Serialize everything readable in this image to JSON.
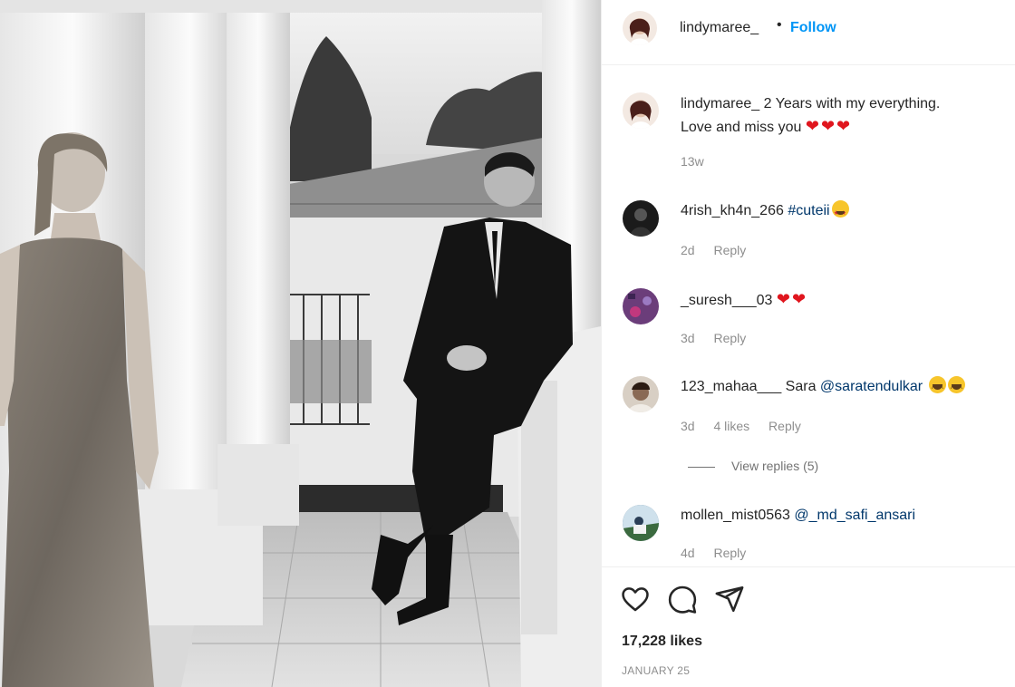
{
  "post": {
    "username": "lindymaree_",
    "separator": "•",
    "follow_label": "Follow",
    "caption": {
      "username": "lindymaree_",
      "text_line1": "2 Years with my everything.",
      "text_line2": "Love and miss you",
      "hearts": "❤❤❤",
      "time": "13w"
    },
    "likes": "17,228 likes",
    "date": "JANUARY 25"
  },
  "comments": [
    {
      "username": "4rish_kh4n_266",
      "mention": "#cuteii",
      "time": "2d",
      "reply": "Reply",
      "avatar_color": "#1b1b1b"
    },
    {
      "username": "_suresh___03",
      "hearts": "❤❤",
      "time": "3d",
      "reply": "Reply",
      "avatar_color": "#6b3d7a"
    },
    {
      "username": "123_mahaa___",
      "text": "Sara",
      "mention": "@saratendulkar",
      "time": "3d",
      "likes": "4 likes",
      "reply": "Reply",
      "avatar_color": "#8a6a55"
    },
    {
      "username": "mollen_mist0563",
      "mention": "@_md_safi_ansari",
      "time": "4d",
      "reply": "Reply",
      "avatar_color": "#4a6f8f"
    }
  ],
  "view_replies": "View replies (5)",
  "icons": [
    "heart-icon",
    "comment-icon",
    "share-icon"
  ],
  "colors": {
    "accent": "#0095f6",
    "mention": "#00376b",
    "heart": "#e0161e",
    "muted": "#8e8e8e"
  }
}
